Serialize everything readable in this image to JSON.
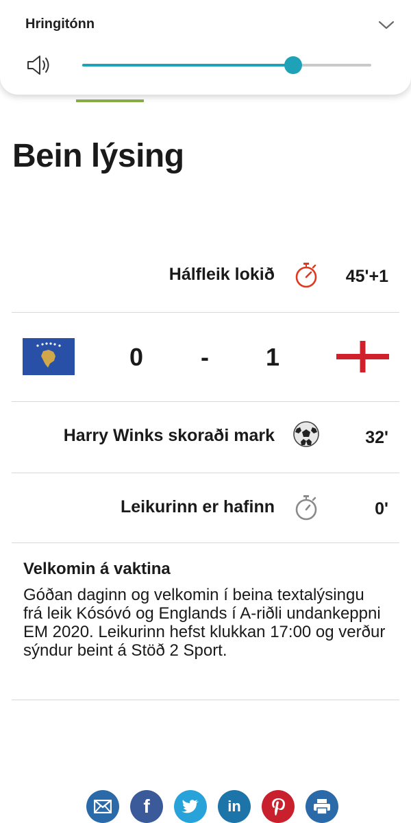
{
  "volume": {
    "title": "Hringitónn",
    "level_percent": 73,
    "accent_color": "#1fa2b8",
    "icons": {
      "expand": "chevron-down-icon",
      "speaker": "speaker-icon"
    }
  },
  "page": {
    "title": "Bein lýsing"
  },
  "events": [
    {
      "text": "Hálfleik lokið",
      "minute": "45'+1",
      "icon": "stopwatch-icon",
      "icon_color": "#e2361f"
    },
    {
      "text": "Harry Winks skoraði mark",
      "minute": "32'",
      "icon": "soccer-ball-icon"
    },
    {
      "text": "Leikurinn er hafinn",
      "minute": "0'",
      "icon": "stopwatch-icon",
      "icon_color": "#8a8a8a"
    }
  ],
  "score": {
    "home_flag": "kosovo-flag",
    "home_goals": "0",
    "separator": "-",
    "away_goals": "1",
    "away_flag": "england-flag"
  },
  "post": {
    "title": "Velkomin á vaktina",
    "body": "Góðan daginn og velkomin í beina textalýsingu frá leik Kósóvó og Englands í A-riðli undankeppni EM 2020. Leikurinn hefst klukkan 17:00 og verður sýndur beint á Stöð 2 Sport."
  },
  "share": [
    {
      "icon": "email-icon",
      "color": "#2a6aa8"
    },
    {
      "icon": "facebook-icon",
      "color": "#3b5a9a"
    },
    {
      "icon": "twitter-icon",
      "color": "#27a3d9"
    },
    {
      "icon": "linkedin-icon",
      "color": "#1d74a8"
    },
    {
      "icon": "pinterest-icon",
      "color": "#c8202c"
    },
    {
      "icon": "print-icon",
      "color": "#2a6aa8"
    }
  ]
}
